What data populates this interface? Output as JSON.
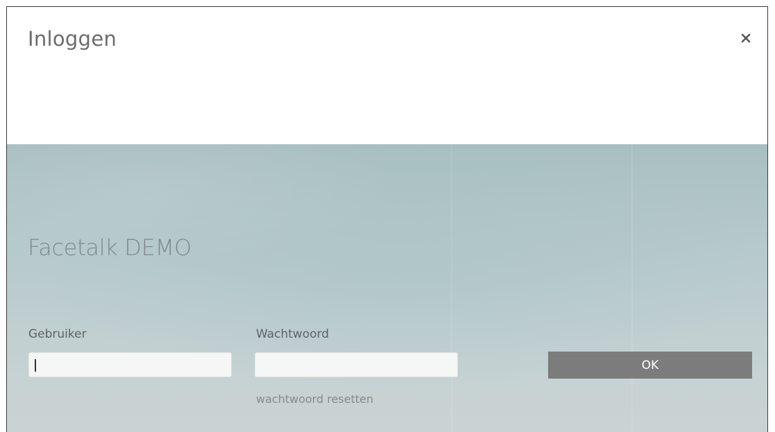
{
  "dialog": {
    "title": "Inloggen",
    "close_icon": "close-icon"
  },
  "brand": {
    "name": "Facetalk DEMO"
  },
  "form": {
    "username_label": "Gebruiker",
    "username_value": "",
    "password_label": "Wachtwoord",
    "password_value": "",
    "submit_label": "OK",
    "reset_link": "wachtwoord resetten"
  },
  "colors": {
    "button_background": "#7c7c7c",
    "title_text": "#6b6b6b",
    "panel_background": "#b3c7c9"
  }
}
